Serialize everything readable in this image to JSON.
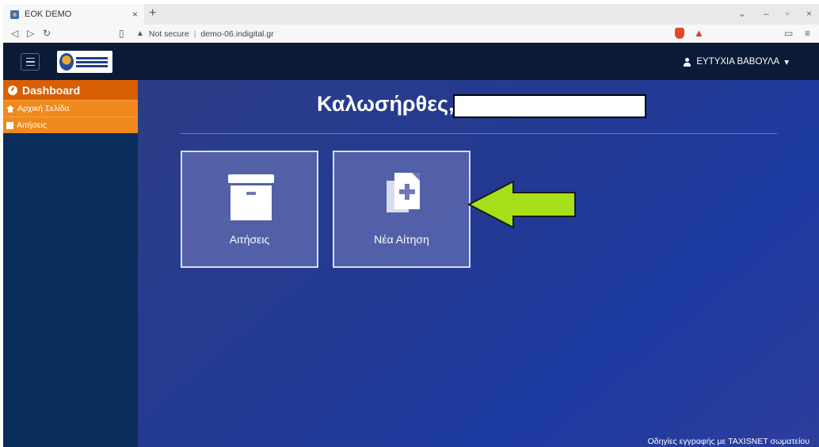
{
  "browser": {
    "tab_title": "EOK DEMO",
    "tab_close": "×",
    "new_tab": "+",
    "security_label": "Not secure",
    "url": "demo-06.indigital.gr"
  },
  "header": {
    "user_name": "ΕΥΤΥΧΙΑ ΒΑΒΟΥΛΑ"
  },
  "sidebar": {
    "heading": "Dashboard",
    "items": [
      {
        "label": "Αρχική Σελίδα"
      },
      {
        "label": "Αιτήσεις"
      }
    ]
  },
  "main": {
    "welcome": "Καλωσήρθες,",
    "tiles": [
      {
        "label": "Αιτήσεις"
      },
      {
        "label": "Νέα Αίτηση"
      }
    ],
    "footer_link": "Οδηγίες εγγραφής με TAXISNET σωματείου"
  },
  "colors": {
    "sidebar_heading": "#d95f05",
    "sidebar_item": "#f08a1c",
    "header_bg": "#0b1a36",
    "annotation_arrow": "#a7e01a"
  },
  "icons": [
    "menu-icon",
    "user-icon",
    "dashboard-icon",
    "home-icon",
    "archive-icon",
    "new-document-icon",
    "arrow-annotation"
  ]
}
